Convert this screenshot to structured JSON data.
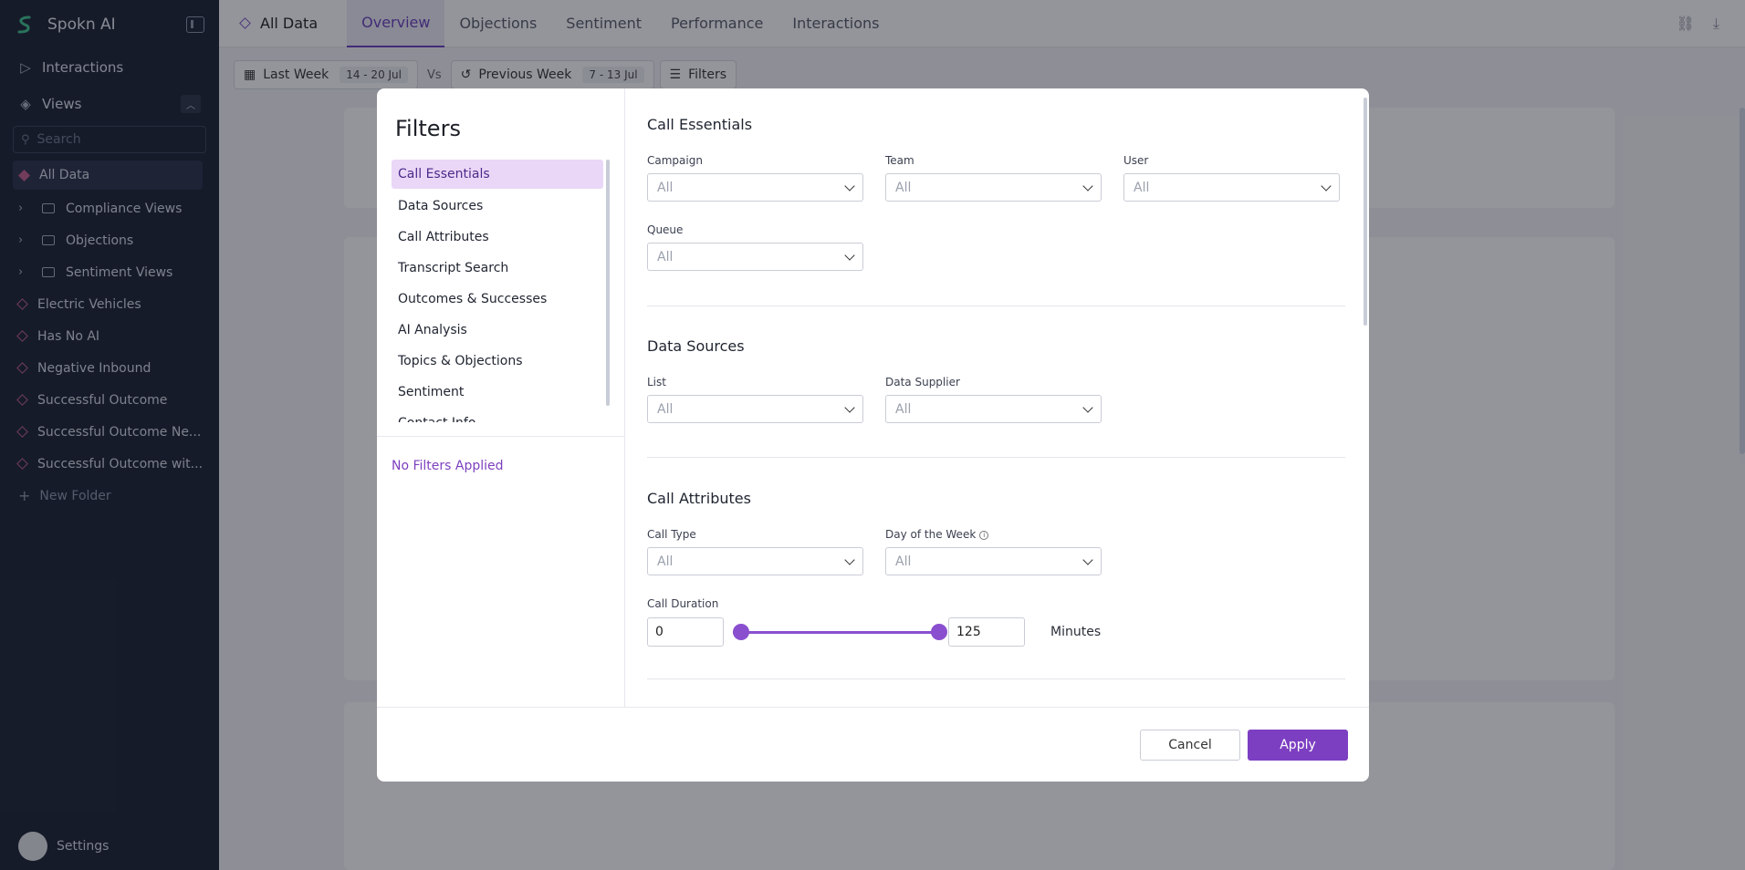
{
  "app": {
    "name": "Spokn AI"
  },
  "colors": {
    "accent": "#7d3fc2",
    "sidebar_bg": "#1b2233",
    "view_diamond": "#c25e8c"
  },
  "sidebar": {
    "interactions_label": "Interactions",
    "views_label": "Views",
    "search_placeholder": "Search",
    "items": [
      {
        "label": "All Data",
        "type": "view",
        "active": true
      },
      {
        "label": "Compliance Views",
        "type": "folder"
      },
      {
        "label": "Objections",
        "type": "folder"
      },
      {
        "label": "Sentiment Views",
        "type": "folder"
      },
      {
        "label": "Electric Vehicles",
        "type": "view"
      },
      {
        "label": "Has No AI",
        "type": "view"
      },
      {
        "label": "Negative Inbound",
        "type": "view"
      },
      {
        "label": "Successful Outcome",
        "type": "view"
      },
      {
        "label": "Successful Outcome Ne...",
        "type": "view"
      },
      {
        "label": "Successful Outcome wit...",
        "type": "view"
      }
    ],
    "new_folder_label": "New Folder",
    "settings_label": "Settings"
  },
  "topbar": {
    "title": "All Data",
    "tabs": [
      "Overview",
      "Objections",
      "Sentiment",
      "Performance",
      "Interactions"
    ],
    "active_tab": "Overview"
  },
  "datebar": {
    "current_label": "Last Week",
    "current_range": "14 - 20 Jul",
    "vs_label": "Vs",
    "previous_label": "Previous Week",
    "previous_range": "7 - 13 Jul",
    "filters_label": "Filters"
  },
  "modal": {
    "title": "Filters",
    "categories": [
      "Call Essentials",
      "Data Sources",
      "Call Attributes",
      "Transcript Search",
      "Outcomes & Successes",
      "AI Analysis",
      "Topics & Objections",
      "Sentiment",
      "Contact Info"
    ],
    "active_category": "Call Essentials",
    "no_filters_text": "No Filters Applied",
    "sections": {
      "call_essentials": {
        "title": "Call Essentials",
        "fields": [
          {
            "label": "Campaign",
            "value": "All"
          },
          {
            "label": "Team",
            "value": "All"
          },
          {
            "label": "User",
            "value": "All"
          },
          {
            "label": "Queue",
            "value": "All"
          }
        ]
      },
      "data_sources": {
        "title": "Data Sources",
        "fields": [
          {
            "label": "List",
            "value": "All"
          },
          {
            "label": "Data Supplier",
            "value": "All"
          }
        ]
      },
      "call_attributes": {
        "title": "Call Attributes",
        "fields": [
          {
            "label": "Call Type",
            "value": "All"
          },
          {
            "label": "Day of the Week",
            "value": "All"
          }
        ],
        "duration": {
          "label": "Call Duration",
          "min": "0",
          "max": "125",
          "unit": "Minutes"
        }
      }
    },
    "cancel_label": "Cancel",
    "apply_label": "Apply"
  }
}
